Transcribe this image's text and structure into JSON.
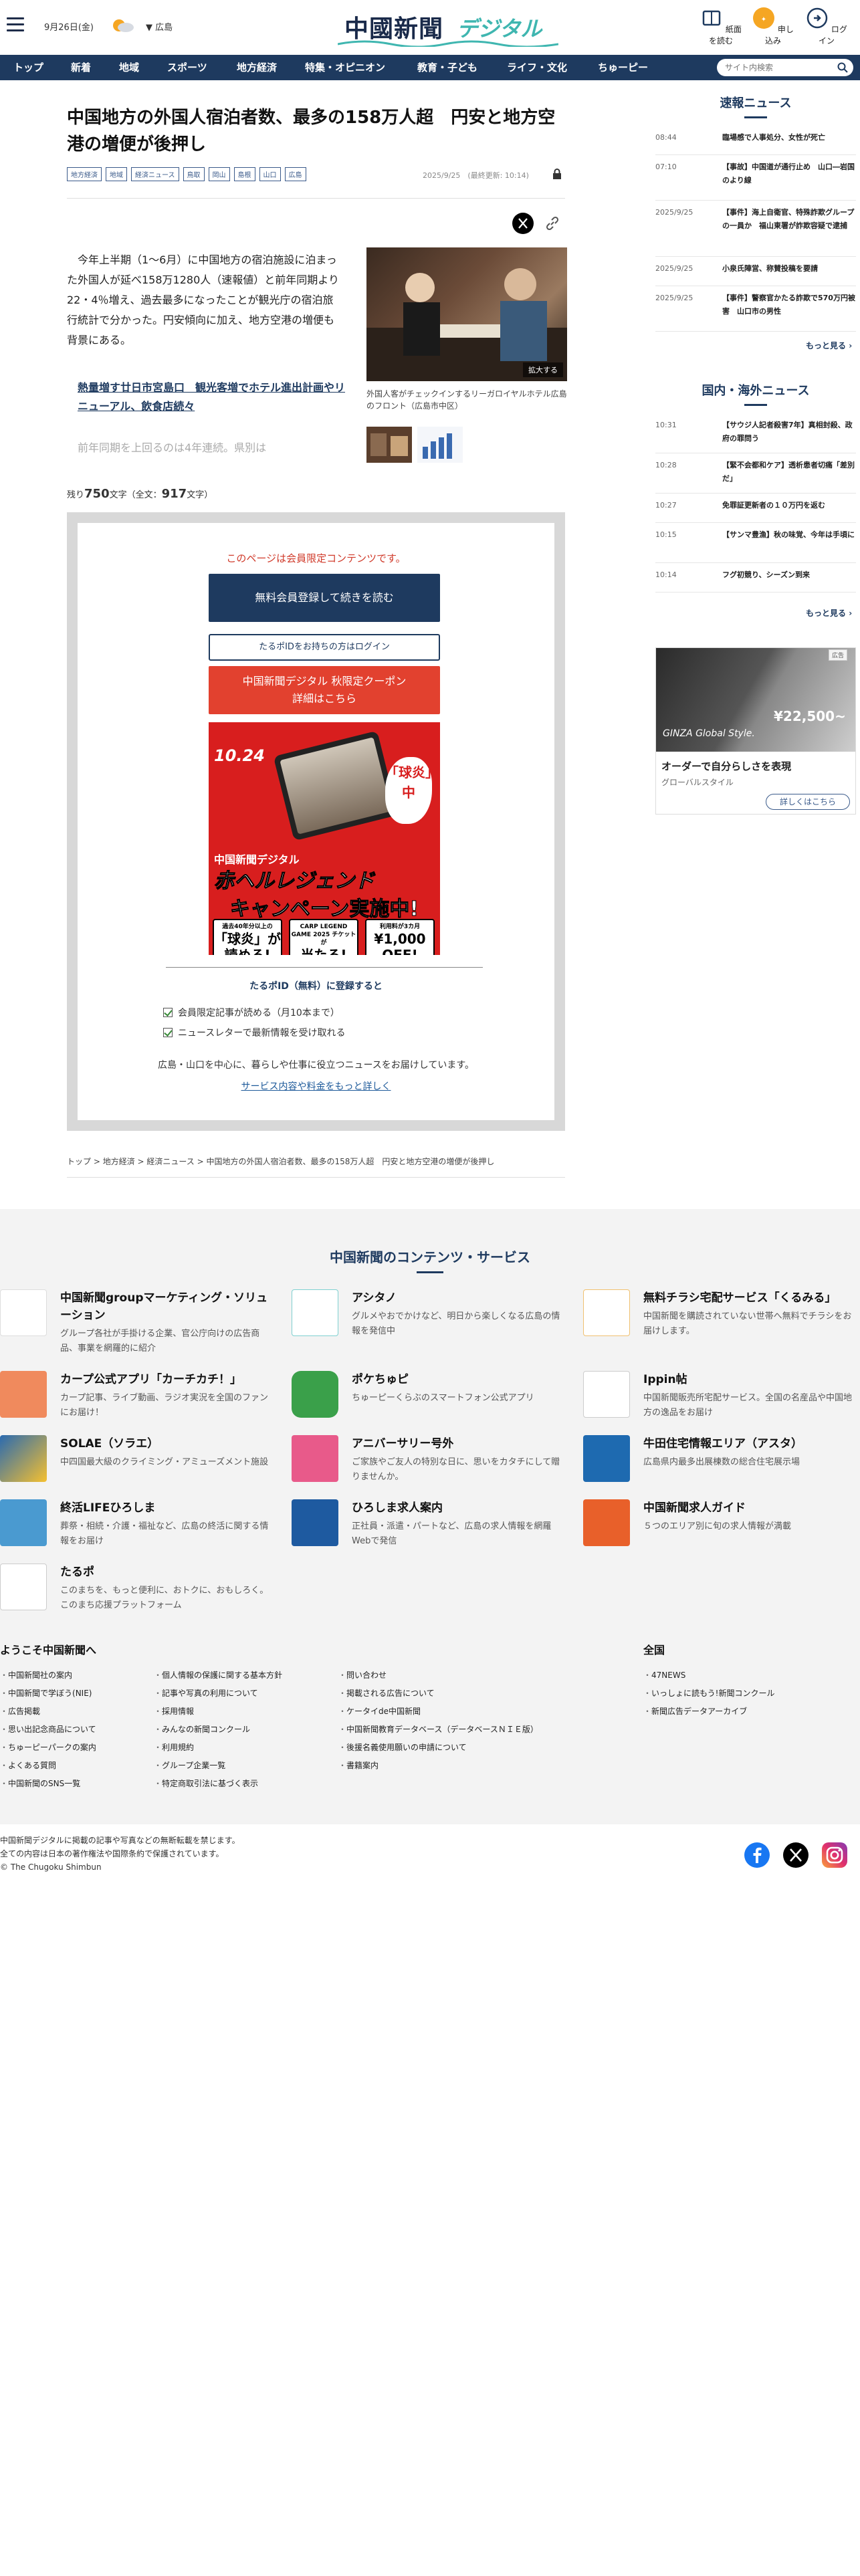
{
  "header": {
    "date": "9月26日(金)",
    "area": "広島",
    "logo_main": "中國新聞",
    "logo_sub": "デジタル",
    "btn_paper": "紙面を読む",
    "btn_signup": "申し込み",
    "btn_login": "ログイン"
  },
  "nav": {
    "items": [
      "トップ",
      "新着",
      "地域",
      "スポーツ",
      "地方経済",
      "特集・オピニオン",
      "教育・子ども",
      "ライフ・文化",
      "ちゅーピー"
    ],
    "search_placeholder": "サイト内検索"
  },
  "article": {
    "title": "中国地方の外国人宿泊者数、最多の158万人超　円安と地方空港の増便が後押し",
    "tags": [
      "地方経済",
      "地域",
      "経済ニュース",
      "鳥取",
      "岡山",
      "島根",
      "山口",
      "広島"
    ],
    "date": "2025/9/25　(最終更新: 10:14)",
    "lead": "今年上半期（1〜6月）に中国地方の宿泊施設に泊まった外国人が延べ158万1280人（速報値）と前年同期より22・4％増え、過去最多になったことが観光庁の宿泊旅行統計で分かった。円安傾向に加え、地方空港の増便も背景にある。",
    "related_link": "熱量増す廿日市宮島口　観光客増でホテル進出計画やリニューアル、飲食店続々",
    "faded": "前年同期を上回るのは4年連続。県別は",
    "photo_zoom": "拡大する",
    "photo_caption": "外国人客がチェックインするリーガロイヤルホテル広島のフロント（広島市中区）",
    "remain_prefix": "残り",
    "remain_count": "750",
    "remain_mid": "文字（全文：",
    "remain_total": "917",
    "remain_suffix": "文字）"
  },
  "paywall": {
    "notice": "このページは会員限定コンテンツです。",
    "register": "無料会員登録して続きを読む",
    "login": "たるポIDをお持ちの方はログイン",
    "coupon_line1": "中国新聞デジタル 秋限定クーポン",
    "coupon_line2": "詳細はこちら",
    "promo_date": "10.24",
    "promo_tag": "「球炎」中",
    "promo_brand": "中国新聞デジタル",
    "promo_campaign": "赤ヘルレジェンド",
    "promo_go": "キャンペーン実施中!",
    "promo_box1_small": "過去40年分以上の",
    "promo_box1_big": "「球炎」が読める!",
    "promo_box2_small": "CARP LEGEND GAME 2025 チケットが",
    "promo_box2_big": "当たる!",
    "promo_box3_small": "利用料が3カ月",
    "promo_box3_big": "¥1,000 OFF!",
    "tarupo": "たるポID（無料）に登録すると",
    "check1": "会員限定記事が読める（月10本まで）",
    "check2": "ニュースレターで最新情報を受け取れる",
    "desc": "広島・山口を中心に、暮らしや仕事に役立つニュースをお届けしています。",
    "more": "サービス内容や料金をもっと詳しく"
  },
  "breadcrumb": [
    "トップ",
    "地方経済",
    "経済ニュース",
    "中国地方の外国人宿泊者数、最多の158万人超　円安と地方空港の増便が後押し"
  ],
  "sidebar": {
    "flash_title": "速報ニュース",
    "flash": [
      {
        "time": "08:44",
        "text": "臨場感で人事処分、女性が死亡"
      },
      {
        "time": "07:10",
        "text": "【事故】中国道が通行止め　山口―岩国のより線"
      },
      {
        "time": "2025/9/25",
        "text": "【事件】海上自衛官、特殊詐欺グループの一員か　福山東署が詐欺容疑で逮捕"
      },
      {
        "time": "2025/9/25",
        "text": "小泉氏陣営、称賛投稿を要請"
      },
      {
        "time": "2025/9/25",
        "text": "【事件】警察官かたる詐欺で570万円被害　山口市の男性"
      }
    ],
    "more": "もっと見る",
    "world_title": "国内・海外ニュース",
    "world": [
      {
        "time": "10:31",
        "text": "【サウジ人記者殺害7年】真相封殺、政府の罪問う"
      },
      {
        "time": "10:28",
        "text": "【緊不会都和ケア】透析患者切痛「差別だ」"
      },
      {
        "time": "10:27",
        "text": "免罪証更新者の１０万円を返む"
      },
      {
        "time": "10:15",
        "text": "【サンマ豊漁】秋の味覚、今年は手頃に"
      },
      {
        "time": "10:14",
        "text": "フグ初競り、シーズン到来"
      }
    ],
    "more2": "もっと見る",
    "ad_badge": "広告",
    "ad_brand": "GINZA Global Style.",
    "ad_price": "¥22,500~",
    "ad_title": "オーダーで自分らしさを表現",
    "ad_sub": "グローバルスタイル",
    "ad_btn": "詳しくはこちら"
  },
  "services": {
    "title": "中国新聞のコンテンツ・サービス",
    "items": [
      {
        "name": "中国新聞groupマーケティング・ソリューション",
        "desc": "グループ各社が手掛ける企業、官公庁向けの広告商品、事業を網羅的に紹介",
        "color": "#ffffff"
      },
      {
        "name": "アシタノ",
        "desc": "グルメやおでかけなど、明日から楽しくなる広島の情報を発信中",
        "color": "#ffffff"
      },
      {
        "name": "無料チラシ宅配サービス「くるみる」",
        "desc": "中国新聞を購読されていない世帯へ無料でチラシをお届けします。",
        "color": "#ffffff"
      },
      {
        "name": "カープ公式アプリ「カーチカチ！」",
        "desc": "カープ記事、ライブ動画、ラジオ実況を全国のファンにお届け！",
        "color": "#f08a5d"
      },
      {
        "name": "ポケちゅピ",
        "desc": "ちゅーピーくらぶのスマートフォン公式アプリ",
        "color": "#3aa04a"
      },
      {
        "name": "Ippin帖",
        "desc": "中国新聞販売所宅配サービス。全国の名産品や中国地方の逸品をお届け",
        "color": "#ffffff"
      },
      {
        "name": "SOLAE（ソラエ）",
        "desc": "中四国最大級のクライミング・アミューズメント施設",
        "color": "#2a6ab0"
      },
      {
        "name": "アニバーサリー号外",
        "desc": "ご家族やご友人の特別な日に、思いをカタチにして贈りませんか。",
        "color": "#e85a8a"
      },
      {
        "name": "牛田住宅情報エリア（アスタ）",
        "desc": "広島県内最多出展棟数の総合住宅展示場",
        "color": "#1e6ab0"
      },
      {
        "name": "終活LIFEひろしま",
        "desc": "葬祭・相続・介護・福祉など、広島の終活に関する情報をお届け",
        "color": "#4a9ad0"
      },
      {
        "name": "ひろしま求人案内",
        "desc": "正社員・派遣・パートなど、広島の求人情報を網羅 Webで発信",
        "color": "#1e5aa0"
      },
      {
        "name": "中国新聞求人ガイド",
        "desc": "５つのエリア別に旬の求人情報が満載",
        "color": "#e8602a"
      },
      {
        "name": "たるポ",
        "desc": "このまちを、もっと便利に、おトクに、おもしろく。このまち応援プラットフォーム",
        "color": "#ffffff"
      }
    ]
  },
  "footer": {
    "col1_title": "ようこそ中国新聞へ",
    "col1": [
      "中国新聞社の案内",
      "中国新聞で学ぼう(NIE)",
      "広告掲載",
      "思い出記念商品について",
      "ちゅーピーパークの案内",
      "よくある質問",
      "中国新聞のSNS一覧"
    ],
    "col2": [
      "個人情報の保護に関する基本方針",
      "記事や写真の利用について",
      "採用情報",
      "みんなの新聞コンクール",
      "利用規約",
      "グループ企業一覧",
      "特定商取引法に基づく表示"
    ],
    "col3": [
      "問い合わせ",
      "掲載される広告について",
      "ケータイde中国新聞",
      "中国新聞教育データベース（データベースＮＩＥ版）",
      "後援名義使用願いの申請について",
      "書籍案内"
    ],
    "col4_title": "全国",
    "col4": [
      "47NEWS",
      "いっしょに読もう!新聞コンクール",
      "新聞広告データアーカイブ"
    ],
    "copy1": "中国新聞デジタルに掲載の記事や写真などの無断転載を禁じます。",
    "copy2": "全ての内容は日本の著作権法や国際条約で保護されています。",
    "copy3": "© The Chugoku Shimbun"
  },
  "colors": {
    "navy": "#1e3a5f",
    "accent_red": "#e2412f",
    "teal": "#3fb6b0"
  }
}
